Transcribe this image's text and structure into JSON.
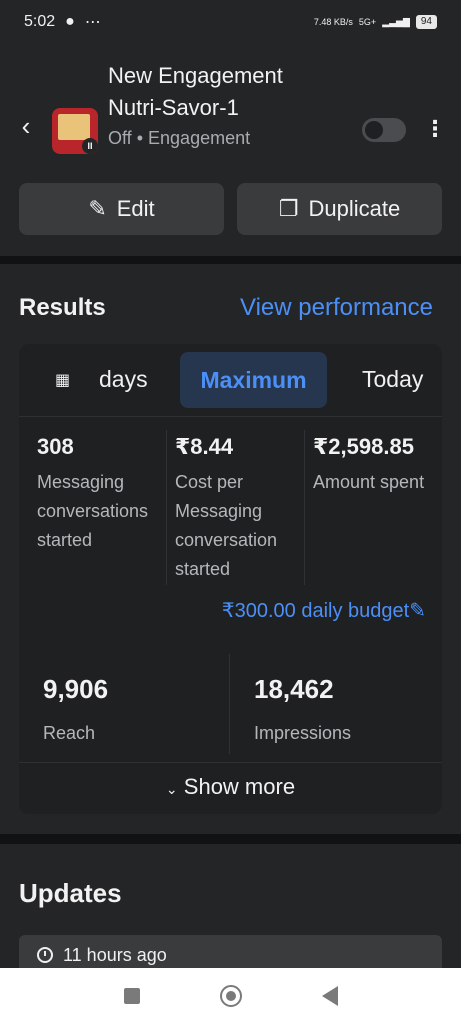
{
  "status_bar": {
    "time": "5:02",
    "speed": "7.48 KB/s",
    "network": "5G+",
    "battery": "94"
  },
  "campaign": {
    "title": "New Engagement Nutri-Savor-1",
    "status": "Off",
    "objective": "Engagement",
    "separator": "•"
  },
  "actions": {
    "edit_label": "Edit",
    "duplicate_label": "Duplicate"
  },
  "results": {
    "title": "Results",
    "view_performance": "View performance",
    "tabs": {
      "days": "days",
      "maximum": "Maximum",
      "today": "Today"
    },
    "metrics": [
      {
        "value": "308",
        "label": "Messaging conversations started"
      },
      {
        "value": "₹8.44",
        "label": "Cost per Messaging conversation started"
      },
      {
        "value": "₹2,598.85",
        "label": "Amount spent"
      }
    ],
    "budget": "₹300.00 daily budget",
    "reach": {
      "value": "9,906",
      "label": "Reach"
    },
    "impressions": {
      "value": "18,462",
      "label": "Impressions"
    },
    "show_more": "Show more"
  },
  "updates": {
    "title": "Updates",
    "first_item": "11 hours ago"
  },
  "colors": {
    "accent": "#4c8ff6",
    "background": "#1c1d1f",
    "surface": "#242526",
    "button": "#3a3b3d"
  },
  "icons": [
    "back-arrow-icon",
    "pause-icon",
    "more-vert-icon",
    "pencil-icon",
    "copy-icon",
    "calendar-icon",
    "chevron-down-icon",
    "clock-icon"
  ]
}
